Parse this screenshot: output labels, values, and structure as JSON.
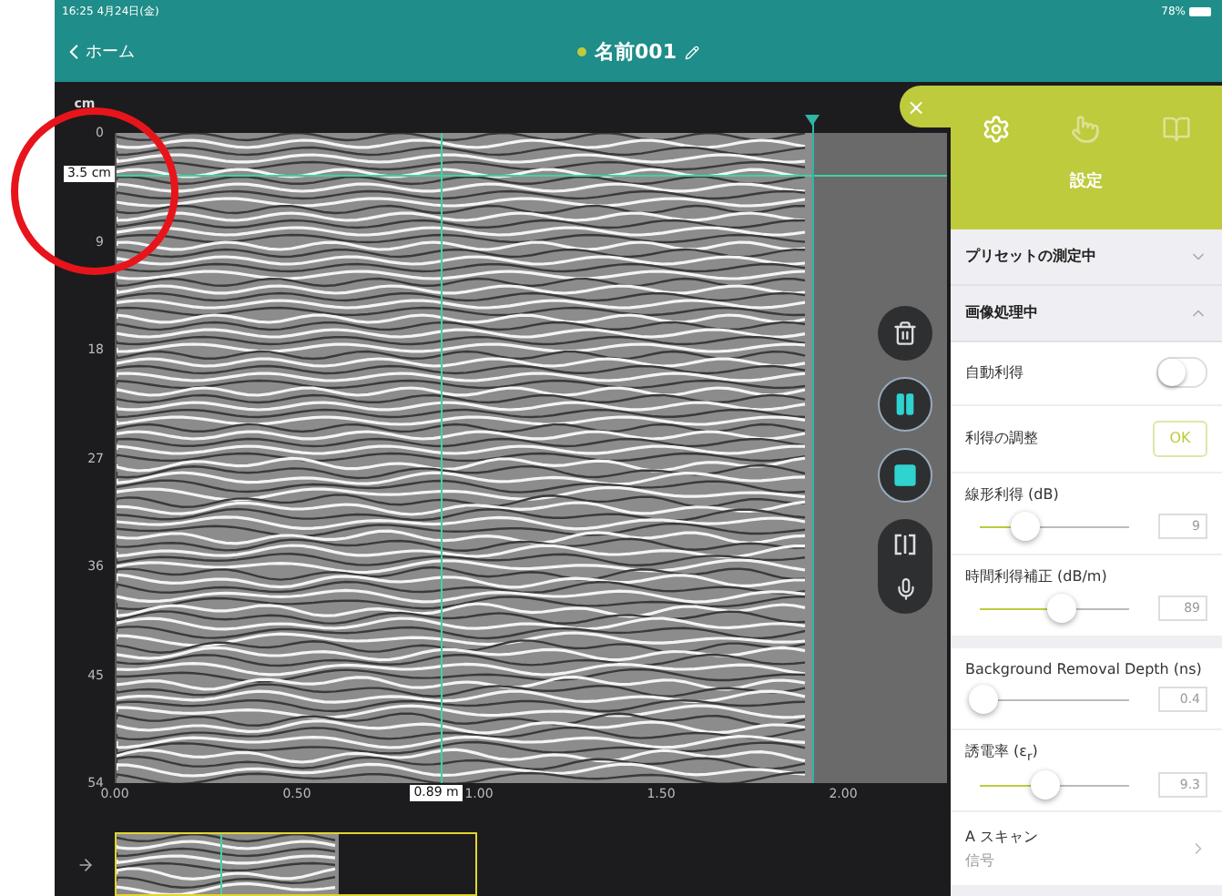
{
  "status_bar": {
    "time": "16:25  4月24日(金)",
    "battery": "78%"
  },
  "nav": {
    "back": "ホーム",
    "title": "名前001"
  },
  "viewer": {
    "unit": "cm",
    "y_ticks": [
      "0",
      "9",
      "18",
      "27",
      "36",
      "45",
      "54"
    ],
    "x_ticks": [
      "0.00",
      "0.50",
      "1.00",
      "1.50",
      "2.00"
    ],
    "depth_cursor": {
      "label": "3.5 cm"
    },
    "distance_cursor": {
      "label": "0.89 m"
    },
    "controls": [
      {
        "kind": "delete"
      },
      {
        "kind": "pause"
      },
      {
        "kind": "stop"
      }
    ],
    "tools": [
      {
        "kind": "split"
      },
      {
        "kind": "mic"
      }
    ]
  },
  "panel": {
    "close": "×",
    "tabs": [
      {
        "kind": "settings",
        "selected": true
      },
      {
        "kind": "touch",
        "selected": false
      },
      {
        "kind": "book",
        "selected": false
      }
    ],
    "tab_label": "設定",
    "sections": [
      {
        "title": "プリセットの測定中",
        "expanded": false
      },
      {
        "title": "画像処理中",
        "expanded": true,
        "groups": [
          [
            {
              "kind": "toggle",
              "label": "自動利得",
              "on": false
            },
            {
              "kind": "button",
              "label": "利得の調整",
              "button": "OK"
            },
            {
              "kind": "slider",
              "label": "線形利得 (dB)",
              "level": 0.3,
              "value": "9"
            },
            {
              "kind": "slider",
              "label": "時間利得補正 (dB/m)",
              "level": 0.55,
              "value": "89"
            }
          ],
          [
            {
              "kind": "slider",
              "label": "Background Removal Depth (ns)",
              "level": 0.02,
              "value": "0.4"
            },
            {
              "kind": "slider",
              "label": "誘電率 (ε$_{r}$)",
              "level": 0.44,
              "value": "9.3"
            },
            {
              "kind": "link",
              "label": "A スキャン",
              "sublabel": "信号"
            }
          ]
        ]
      }
    ]
  }
}
